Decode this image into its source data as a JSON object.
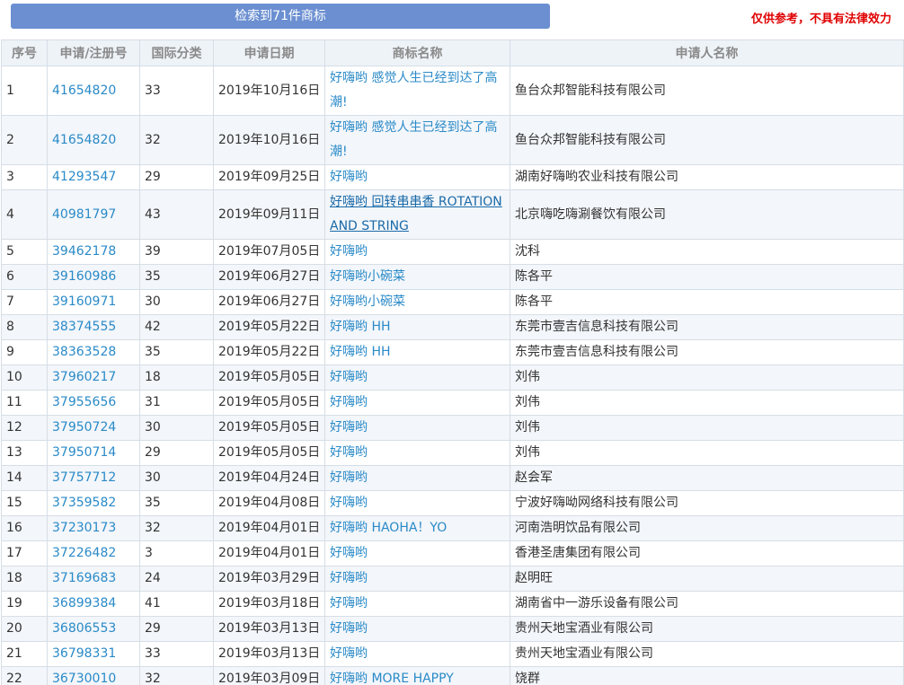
{
  "header": {
    "result_label": "检索到71件商标",
    "disclaimer": "仅供参考，不具有法律效力"
  },
  "table": {
    "columns": [
      "序号",
      "申请/注册号",
      "国际分类",
      "申请日期",
      "商标名称",
      "申请人名称"
    ],
    "rows": [
      {
        "idx": "1",
        "regno": "41654820",
        "cls": "33",
        "date": "2019年10月16日",
        "mark": "好嗨哟 感觉人生已经到达了高潮!",
        "applicant": "鱼台众邦智能科技有限公司"
      },
      {
        "idx": "2",
        "regno": "41654820",
        "cls": "32",
        "date": "2019年10月16日",
        "mark": "好嗨哟 感觉人生已经到达了高潮!",
        "applicant": "鱼台众邦智能科技有限公司"
      },
      {
        "idx": "3",
        "regno": "41293547",
        "cls": "29",
        "date": "2019年09月25日",
        "mark": "好嗨哟",
        "applicant": "湖南好嗨哟农业科技有限公司"
      },
      {
        "idx": "4",
        "regno": "40981797",
        "cls": "43",
        "date": "2019年09月11日",
        "mark": "好嗨哟 回转串串香 ROTATION AND STRING",
        "applicant": "北京嗨吃嗨涮餐饮有限公司",
        "underline": true
      },
      {
        "idx": "5",
        "regno": "39462178",
        "cls": "39",
        "date": "2019年07月05日",
        "mark": "好嗨哟",
        "applicant": "沈科"
      },
      {
        "idx": "6",
        "regno": "39160986",
        "cls": "35",
        "date": "2019年06月27日",
        "mark": "好嗨哟小碗菜",
        "applicant": "陈各平"
      },
      {
        "idx": "7",
        "regno": "39160971",
        "cls": "30",
        "date": "2019年06月27日",
        "mark": "好嗨哟小碗菜",
        "applicant": "陈各平"
      },
      {
        "idx": "8",
        "regno": "38374555",
        "cls": "42",
        "date": "2019年05月22日",
        "mark": "好嗨哟 HH",
        "applicant": "东莞市壹吉信息科技有限公司"
      },
      {
        "idx": "9",
        "regno": "38363528",
        "cls": "35",
        "date": "2019年05月22日",
        "mark": "好嗨哟 HH",
        "applicant": "东莞市壹吉信息科技有限公司"
      },
      {
        "idx": "10",
        "regno": "37960217",
        "cls": "18",
        "date": "2019年05月05日",
        "mark": "好嗨哟",
        "applicant": "刘伟"
      },
      {
        "idx": "11",
        "regno": "37955656",
        "cls": "31",
        "date": "2019年05月05日",
        "mark": "好嗨哟",
        "applicant": "刘伟"
      },
      {
        "idx": "12",
        "regno": "37950724",
        "cls": "30",
        "date": "2019年05月05日",
        "mark": "好嗨哟",
        "applicant": "刘伟"
      },
      {
        "idx": "13",
        "regno": "37950714",
        "cls": "29",
        "date": "2019年05月05日",
        "mark": "好嗨哟",
        "applicant": "刘伟"
      },
      {
        "idx": "14",
        "regno": "37757712",
        "cls": "30",
        "date": "2019年04月24日",
        "mark": "好嗨哟",
        "applicant": "赵会军"
      },
      {
        "idx": "15",
        "regno": "37359582",
        "cls": "35",
        "date": "2019年04月08日",
        "mark": "好嗨哟",
        "applicant": "宁波好嗨呦网络科技有限公司"
      },
      {
        "idx": "16",
        "regno": "37230173",
        "cls": "32",
        "date": "2019年04月01日",
        "mark": "好嗨哟 HAOHA！YO",
        "applicant": "河南浩明饮品有限公司"
      },
      {
        "idx": "17",
        "regno": "37226482",
        "cls": "3",
        "date": "2019年04月01日",
        "mark": "好嗨哟",
        "applicant": "香港圣唐集团有限公司"
      },
      {
        "idx": "18",
        "regno": "37169683",
        "cls": "24",
        "date": "2019年03月29日",
        "mark": "好嗨哟",
        "applicant": "赵明旺"
      },
      {
        "idx": "19",
        "regno": "36899384",
        "cls": "41",
        "date": "2019年03月18日",
        "mark": "好嗨哟",
        "applicant": "湖南省中一游乐设备有限公司"
      },
      {
        "idx": "20",
        "regno": "36806553",
        "cls": "29",
        "date": "2019年03月13日",
        "mark": "好嗨哟",
        "applicant": "贵州天地宝酒业有限公司"
      },
      {
        "idx": "21",
        "regno": "36798331",
        "cls": "33",
        "date": "2019年03月13日",
        "mark": "好嗨哟",
        "applicant": "贵州天地宝酒业有限公司"
      },
      {
        "idx": "22",
        "regno": "36730010",
        "cls": "32",
        "date": "2019年03月09日",
        "mark": "好嗨哟 MORE HAPPY",
        "applicant": "饶群"
      }
    ]
  }
}
